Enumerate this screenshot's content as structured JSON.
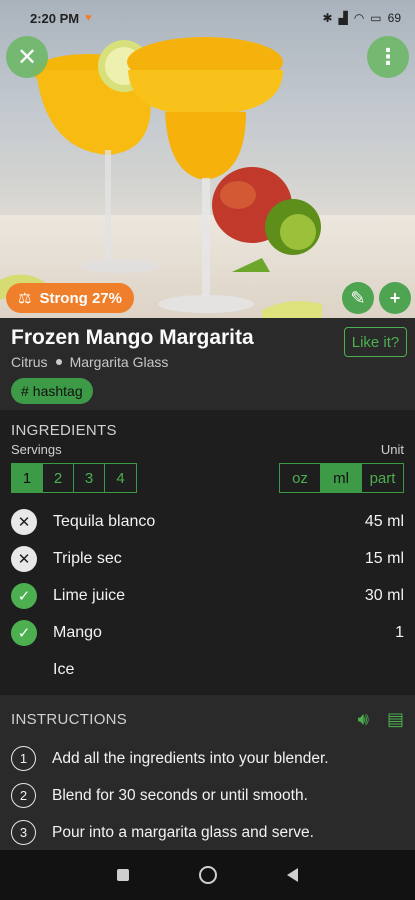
{
  "status": {
    "time": "2:20 PM",
    "battery": "69"
  },
  "hero": {
    "strength_label": "Strong 27%"
  },
  "drink": {
    "title": "Frozen Mango Margarita",
    "category": "Citrus",
    "glass": "Margarita Glass",
    "hashtag": "hashtag",
    "like_label": "Like it?"
  },
  "ingredients": {
    "heading": "INGREDIENTS",
    "servings_label": "Servings",
    "unit_label": "Unit",
    "servings": [
      "1",
      "2",
      "3",
      "4"
    ],
    "units": [
      "oz",
      "ml",
      "part"
    ],
    "items": [
      {
        "name": "Tequila blanco",
        "amount": "45 ml"
      },
      {
        "name": "Triple sec",
        "amount": "15 ml"
      },
      {
        "name": "Lime juice",
        "amount": "30 ml"
      },
      {
        "name": "Mango",
        "amount": "1"
      },
      {
        "name": "Ice",
        "amount": ""
      }
    ]
  },
  "instructions": {
    "heading": "INSTRUCTIONS",
    "steps": [
      {
        "num": "1",
        "text": "Add all the ingredients into your blender."
      },
      {
        "num": "2",
        "text": "Blend for 30 seconds or until smooth."
      },
      {
        "num": "3",
        "text": "Pour into a margarita glass and serve."
      }
    ]
  },
  "colors": {
    "accent": "#4caf50",
    "strength": "#f07f2b"
  }
}
